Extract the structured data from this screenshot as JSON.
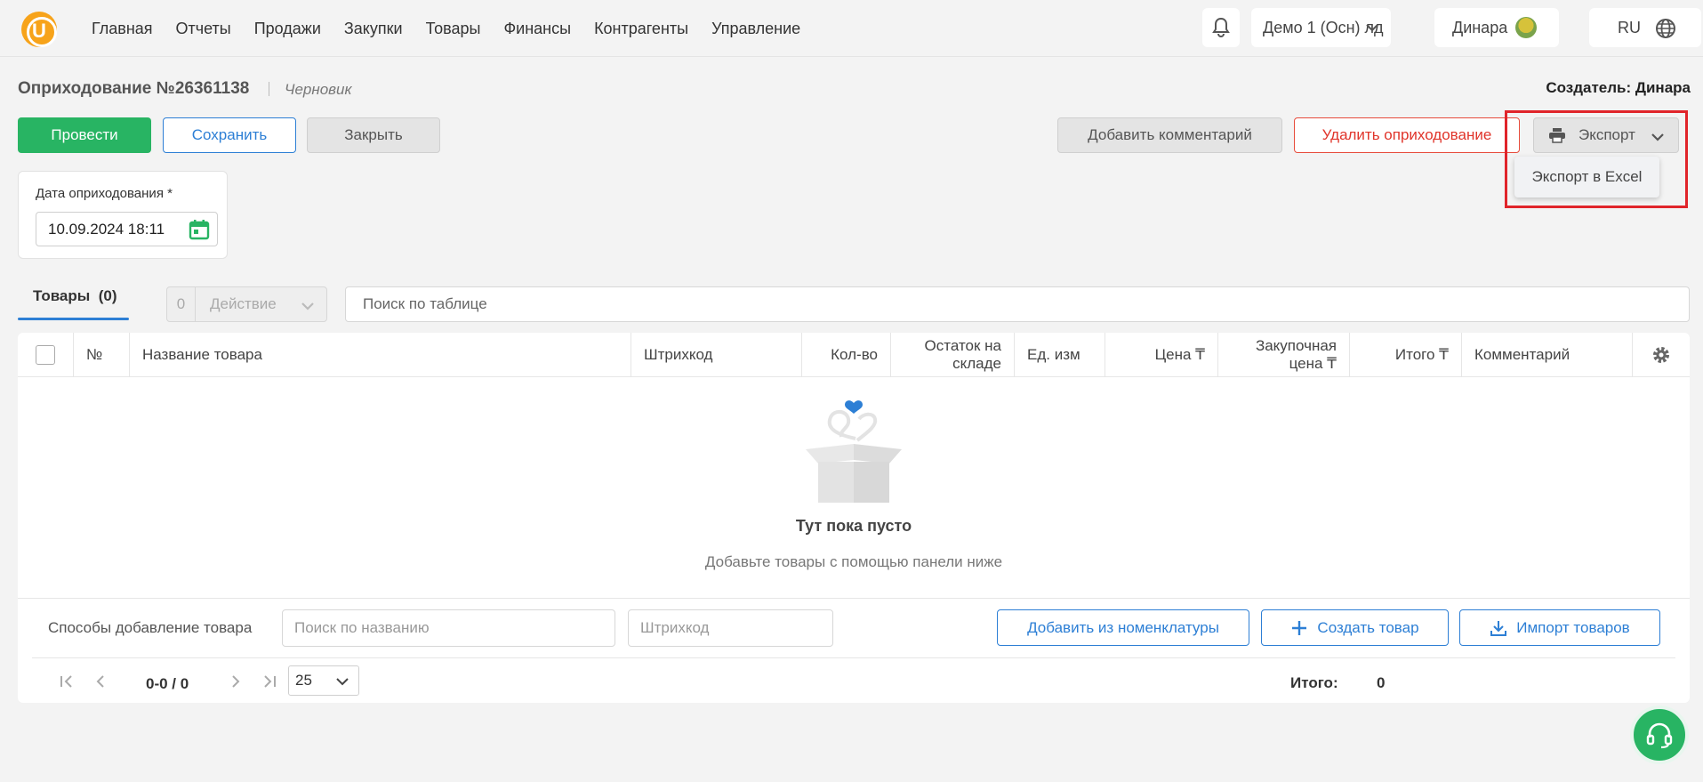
{
  "nav": {
    "logo_letter": "U",
    "items": [
      "Главная",
      "Отчеты",
      "Продажи",
      "Закупки",
      "Товары",
      "Финансы",
      "Контрагенты",
      "Управление"
    ],
    "company": "Демо 1 (Осн) лд",
    "user": "Динара",
    "lang": "RU"
  },
  "doc": {
    "title": "Оприходование №26361138",
    "status": "Черновик",
    "creator": "Создатель: Динара"
  },
  "actions": {
    "post": "Провести",
    "save": "Сохранить",
    "close": "Закрыть",
    "comment": "Добавить комментарий",
    "delete": "Удалить оприходование",
    "export": "Экспорт",
    "export_excel": "Экспорт в Excel"
  },
  "date": {
    "label": "Дата оприходования *",
    "value": "10.09.2024 18:11"
  },
  "tabs": {
    "goods": "Товары",
    "goods_count": "(0)",
    "selected_count": "0",
    "action": "Действие",
    "search_placeholder": "Поиск по таблице"
  },
  "table": {
    "columns": [
      "№",
      "Название товара",
      "Штрихкод",
      "Кол-во",
      "Остаток на складе",
      "Ед. изм",
      "Цена ₸",
      "Закупочная цена ₸",
      "Итого ₸",
      "Комментарий"
    ],
    "empty_title": "Тут пока пусто",
    "empty_sub": "Добавьте товары с помощью панели ниже"
  },
  "add": {
    "label": "Способы добавление товара",
    "name_placeholder": "Поиск по названию",
    "barcode_placeholder": "Штрихкод",
    "from_nomenclature": "Добавить из номенклатуры",
    "create": "Создать товар",
    "import": "Импорт товаров"
  },
  "pager": {
    "count": "0-0 / 0",
    "per_page": "25",
    "total_label": "Итого:",
    "total_value": "0"
  },
  "colors": {
    "primary": "#2d7fd5",
    "success": "#28b463",
    "danger": "#e0342a",
    "brand": "#f7a31a"
  },
  "icons": [
    "bell-icon",
    "chevron-down-icon",
    "globe-icon",
    "printer-icon",
    "calendar-icon",
    "gear-icon",
    "plus-icon",
    "download-icon",
    "headset-icon",
    "first-page-icon",
    "prev-page-icon",
    "next-page-icon",
    "last-page-icon"
  ]
}
